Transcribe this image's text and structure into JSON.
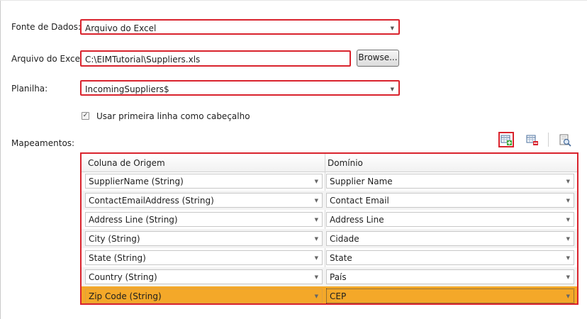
{
  "form": {
    "source_label": "Fonte de Dados:",
    "source_value": "Arquivo do Excel",
    "file_label": "Arquivo do Excel:",
    "file_value": "C:\\EIMTutorial\\Suppliers.xls",
    "browse_label": "Browse...",
    "sheet_label": "Planilha:",
    "sheet_value": "IncomingSuppliers$",
    "header_checkbox_label": "Usar primeira linha como cabeçalho",
    "header_checkbox_checked": true,
    "mappings_label": "Mapeamentos:"
  },
  "toolbar": {
    "icons": [
      "add-mapping-icon",
      "remove-mapping-icon",
      "preview-icon"
    ]
  },
  "grid": {
    "columns": [
      "Coluna de Origem",
      "Domínio"
    ],
    "rows": [
      {
        "source": "SupplierName (String)",
        "domain": "Supplier Name"
      },
      {
        "source": "ContactEmailAddress (String)",
        "domain": "Contact Email"
      },
      {
        "source": "Address Line (String)",
        "domain": "Address Line"
      },
      {
        "source": "City (String)",
        "domain": "Cidade"
      },
      {
        "source": "State (String)",
        "domain": "State"
      },
      {
        "source": "Country (String)",
        "domain": "País"
      },
      {
        "source": "Zip Code (String)",
        "domain": "CEP"
      }
    ],
    "selected_row": 6
  },
  "colors": {
    "highlight_border": "#d9232d",
    "selected_row": "#f4a829"
  }
}
